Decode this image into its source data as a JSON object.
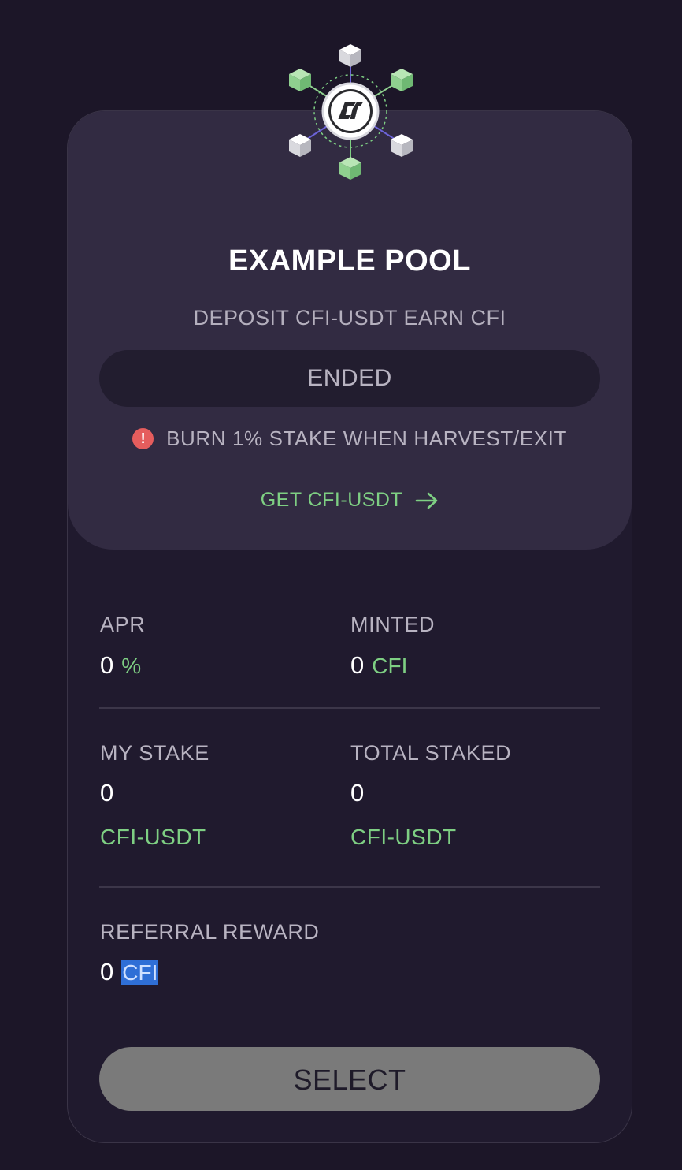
{
  "pool": {
    "title": "EXAMPLE POOL",
    "subtitle": "DEPOSIT CFI-USDT EARN CFI",
    "status": "ENDED",
    "warning": "BURN 1% STAKE WHEN HARVEST/EXIT",
    "get_link": "GET CFI-USDT"
  },
  "stats": {
    "apr": {
      "label": "APR",
      "value": "0",
      "unit": "%"
    },
    "minted": {
      "label": "MINTED",
      "value": "0",
      "unit": "CFI"
    },
    "my_stake": {
      "label": "MY STAKE",
      "value": "0",
      "unit": "CFI-USDT"
    },
    "total_staked": {
      "label": "TOTAL STAKED",
      "value": "0",
      "unit": "CFI-USDT"
    },
    "referral_reward": {
      "label": "REFERRAL REWARD",
      "value": "0",
      "unit": "CFI"
    }
  },
  "actions": {
    "select_label": "SELECT"
  },
  "icons": {
    "logo": "cfi-network-logo-icon",
    "warning": "alert-circle-icon",
    "arrow": "arrow-right-icon"
  },
  "colors": {
    "accent_green": "#7ecf83",
    "warning_red": "#e55d5d",
    "selection_blue": "#2f6fd6"
  }
}
